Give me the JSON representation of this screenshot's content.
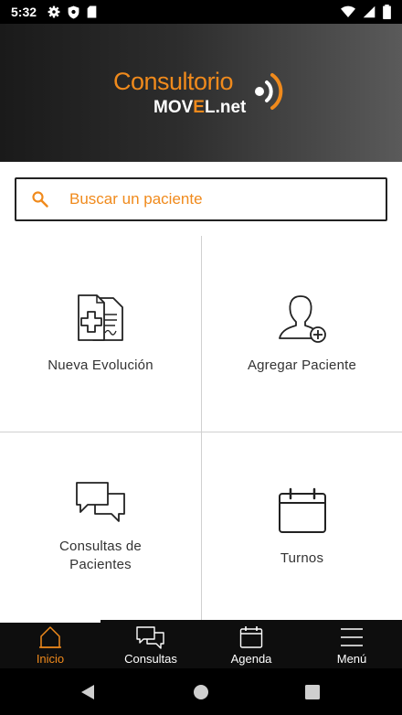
{
  "status_bar": {
    "time": "5:32"
  },
  "header": {
    "logo_title": "Consultorio",
    "logo_sub_pre": "MOV",
    "logo_sub_mid": "E",
    "logo_sub_post": "L.net"
  },
  "search": {
    "placeholder": "Buscar un paciente",
    "value": ""
  },
  "tiles": [
    {
      "label": "Nueva Evolución",
      "icon": "medical-document-icon"
    },
    {
      "label": "Agregar Paciente",
      "icon": "add-user-icon"
    },
    {
      "label_line1": "Consultas de",
      "label_line2": "Pacientes",
      "icon": "chat-bubbles-icon"
    },
    {
      "label": "Turnos",
      "icon": "calendar-icon"
    }
  ],
  "bottom_nav": [
    {
      "label": "Inicio",
      "icon": "home-icon",
      "active": true
    },
    {
      "label": "Consultas",
      "icon": "chat-icon",
      "active": false
    },
    {
      "label": "Agenda",
      "icon": "calendar-icon",
      "active": false
    },
    {
      "label": "Menú",
      "icon": "hamburger-menu-icon",
      "active": false
    }
  ],
  "colors": {
    "accent": "#f08a1c",
    "nav_background": "#0e0e0e",
    "text": "#333333"
  }
}
